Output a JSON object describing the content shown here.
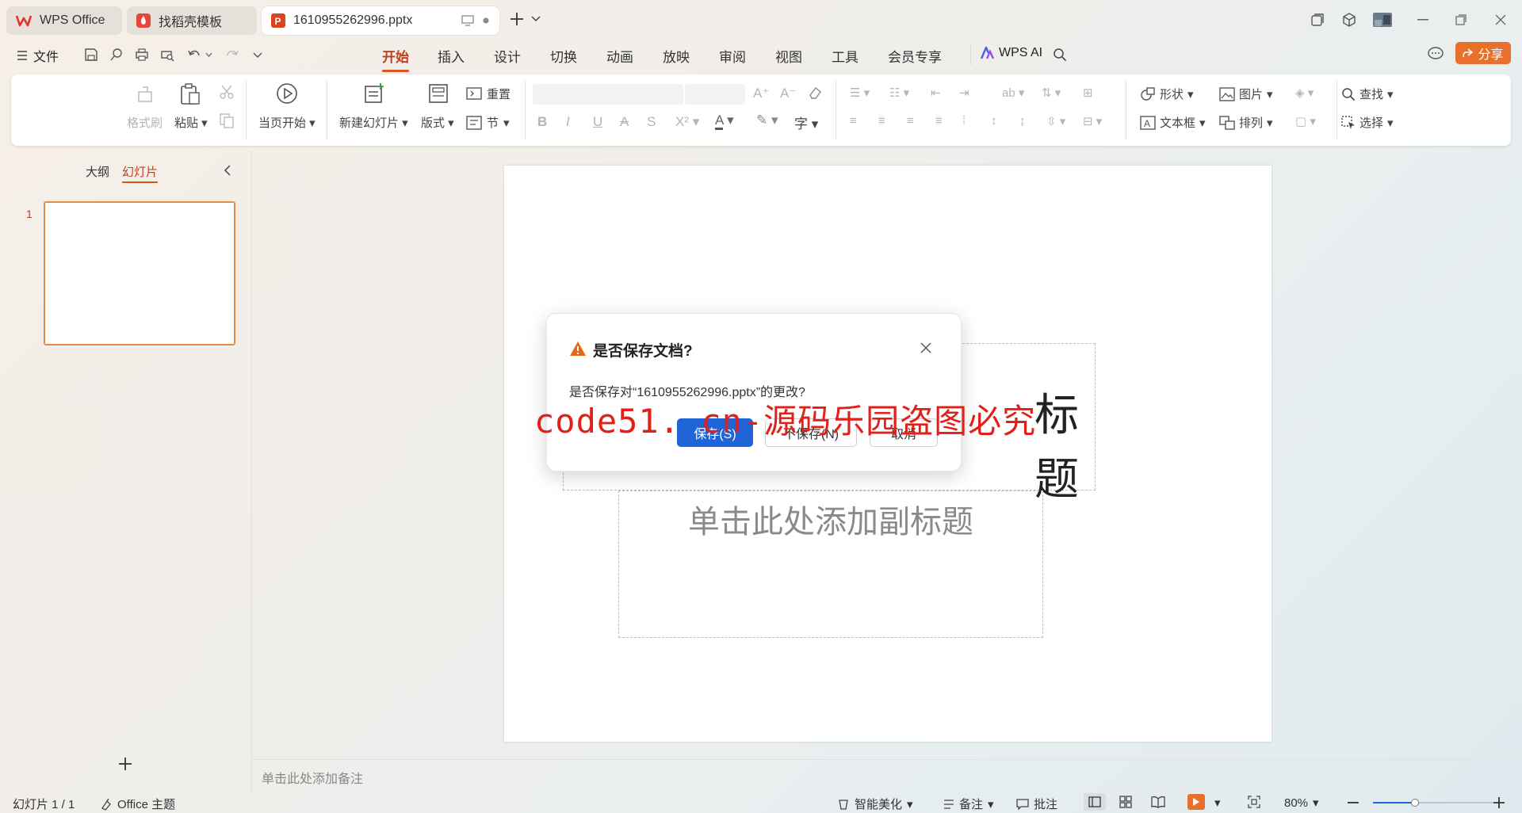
{
  "tabs": [
    {
      "label": "WPS Office",
      "icon": "wps-logo-icon"
    },
    {
      "label": "找稻壳模板",
      "icon": "docer-icon"
    },
    {
      "label": "1610955262996.pptx",
      "icon": "presentation-file-icon"
    }
  ],
  "menu": {
    "file_label": "文件",
    "tabs": [
      "开始",
      "插入",
      "设计",
      "切换",
      "动画",
      "放映",
      "审阅",
      "视图",
      "工具",
      "会员专享"
    ],
    "active_tab": "开始",
    "wps_ai_label": "WPS AI",
    "share_label": "分享",
    "accent_color": "#d9541e"
  },
  "ribbon": {
    "format_painter": "格式刷",
    "paste": "粘贴",
    "play_from_current": "当页开始",
    "new_slide": "新建幻灯片",
    "layout": "版式",
    "reset": "重置",
    "section": "节",
    "shape": "形状",
    "picture": "图片",
    "textbox": "文本框",
    "arrange": "排列",
    "find": "查找",
    "select": "选择"
  },
  "left_panel": {
    "outline_label": "大纲",
    "slides_label": "幻灯片",
    "slide_number": "1"
  },
  "slide": {
    "title_partial": "标题",
    "subtitle_placeholder": "单击此处添加副标题"
  },
  "notes_placeholder": "单击此处添加备注",
  "status": {
    "slide_indicator": "幻灯片 1 / 1",
    "theme": "Office 主题",
    "smart_beautify": "智能美化",
    "notes": "备注",
    "comments": "批注",
    "zoom": "80%"
  },
  "dialog": {
    "title": "是否保存文档?",
    "message": "是否保存对“1610955262996.pptx”的更改?",
    "save_button": "保存(S)",
    "dont_save_button": "不保存(N)",
    "cancel_button": "取消",
    "primary_color": "#2065d8"
  },
  "watermark": "code51. cn-源码乐园盗图必究"
}
